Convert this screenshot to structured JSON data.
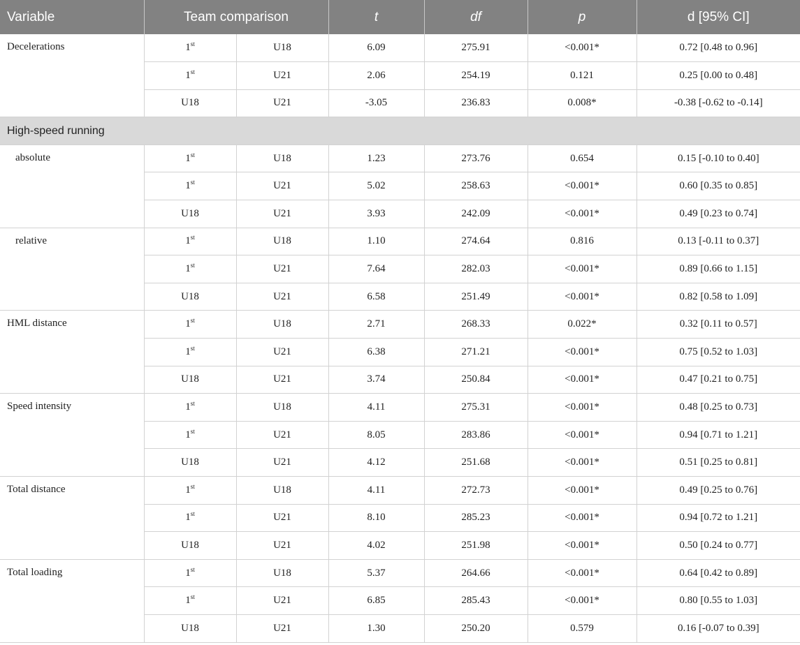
{
  "header": {
    "variable": "Variable",
    "team_comparison": "Team comparison",
    "t": "t",
    "df": "df",
    "p": "p",
    "d": "d [95% CI]"
  },
  "decelerations": {
    "label": "Decelerations",
    "rows": [
      {
        "a": "1",
        "a_sup": "st",
        "b": "U18",
        "t": "6.09",
        "df": "275.91",
        "p": "<0.001*",
        "d": "0.72 [0.48 to 0.96]"
      },
      {
        "a": "1",
        "a_sup": "st",
        "b": "U21",
        "t": "2.06",
        "df": "254.19",
        "p": "0.121",
        "d": "0.25 [0.00 to 0.48]"
      },
      {
        "a": "U18",
        "a_sup": "",
        "b": "U21",
        "t": "-3.05",
        "df": "236.83",
        "p": "0.008*",
        "d": "-0.38 [-0.62 to -0.14]"
      }
    ]
  },
  "hsr_section": "High-speed running",
  "absolute": {
    "label": "absolute",
    "rows": [
      {
        "a": "1",
        "a_sup": "st",
        "b": "U18",
        "t": "1.23",
        "df": "273.76",
        "p": "0.654",
        "d": "0.15 [-0.10 to 0.40]"
      },
      {
        "a": "1",
        "a_sup": "st",
        "b": "U21",
        "t": "5.02",
        "df": "258.63",
        "p": "<0.001*",
        "d": "0.60 [0.35 to 0.85]"
      },
      {
        "a": "U18",
        "a_sup": "",
        "b": "U21",
        "t": "3.93",
        "df": "242.09",
        "p": "<0.001*",
        "d": "0.49 [0.23 to 0.74]"
      }
    ]
  },
  "relative": {
    "label": "relative",
    "rows": [
      {
        "a": "1",
        "a_sup": "st",
        "b": "U18",
        "t": "1.10",
        "df": "274.64",
        "p": "0.816",
        "d": "0.13 [-0.11 to 0.37]"
      },
      {
        "a": "1",
        "a_sup": "st",
        "b": "U21",
        "t": "7.64",
        "df": "282.03",
        "p": "<0.001*",
        "d": "0.89 [0.66 to 1.15]"
      },
      {
        "a": "U18",
        "a_sup": "",
        "b": "U21",
        "t": "6.58",
        "df": "251.49",
        "p": "<0.001*",
        "d": "0.82 [0.58 to 1.09]"
      }
    ]
  },
  "hml": {
    "label": "HML distance",
    "rows": [
      {
        "a": "1",
        "a_sup": "st",
        "b": "U18",
        "t": "2.71",
        "df": "268.33",
        "p": "0.022*",
        "d": "0.32 [0.11 to 0.57]"
      },
      {
        "a": "1",
        "a_sup": "st",
        "b": "U21",
        "t": "6.38",
        "df": "271.21",
        "p": "<0.001*",
        "d": "0.75 [0.52 to 1.03]"
      },
      {
        "a": "U18",
        "a_sup": "",
        "b": "U21",
        "t": "3.74",
        "df": "250.84",
        "p": "<0.001*",
        "d": "0.47 [0.21 to 0.75]"
      }
    ]
  },
  "speed": {
    "label": "Speed intensity",
    "rows": [
      {
        "a": "1",
        "a_sup": "st",
        "b": "U18",
        "t": "4.11",
        "df": "275.31",
        "p": "<0.001*",
        "d": "0.48 [0.25 to 0.73]"
      },
      {
        "a": "1",
        "a_sup": "st",
        "b": "U21",
        "t": "8.05",
        "df": "283.86",
        "p": "<0.001*",
        "d": "0.94 [0.71 to 1.21]"
      },
      {
        "a": "U18",
        "a_sup": "",
        "b": "U21",
        "t": "4.12",
        "df": "251.68",
        "p": "<0.001*",
        "d": "0.51 [0.25 to 0.81]"
      }
    ]
  },
  "total_distance": {
    "label": "Total distance",
    "rows": [
      {
        "a": "1",
        "a_sup": "st",
        "b": "U18",
        "t": "4.11",
        "df": "272.73",
        "p": "<0.001*",
        "d": "0.49 [0.25 to 0.76]"
      },
      {
        "a": "1",
        "a_sup": "st",
        "b": "U21",
        "t": "8.10",
        "df": "285.23",
        "p": "<0.001*",
        "d": "0.94 [0.72 to 1.21]"
      },
      {
        "a": "U18",
        "a_sup": "",
        "b": "U21",
        "t": "4.02",
        "df": "251.98",
        "p": "<0.001*",
        "d": "0.50 [0.24 to 0.77]"
      }
    ]
  },
  "total_loading": {
    "label": "Total loading",
    "rows": [
      {
        "a": "1",
        "a_sup": "st",
        "b": "U18",
        "t": "5.37",
        "df": "264.66",
        "p": "<0.001*",
        "d": "0.64 [0.42 to 0.89]"
      },
      {
        "a": "1",
        "a_sup": "st",
        "b": "U21",
        "t": "6.85",
        "df": "285.43",
        "p": "<0.001*",
        "d": "0.80 [0.55 to 1.03]"
      },
      {
        "a": "U18",
        "a_sup": "",
        "b": "U21",
        "t": "1.30",
        "df": "250.20",
        "p": "0.579",
        "d": "0.16 [-0.07 to 0.39]"
      }
    ]
  }
}
